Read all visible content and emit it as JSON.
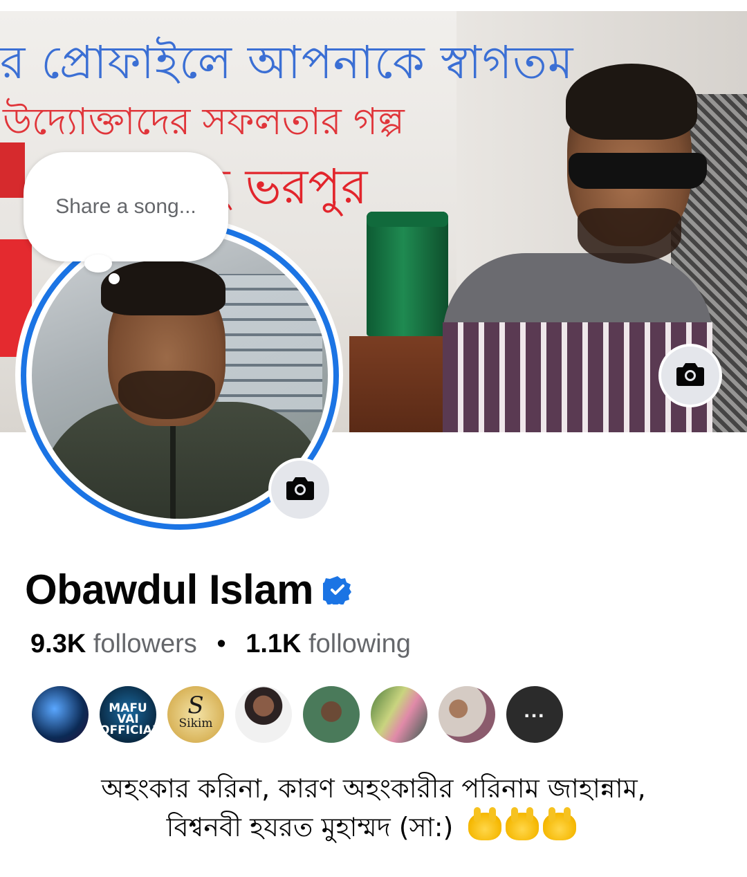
{
  "cover": {
    "banner_line1": "র প্রোফাইলে আপনাকে স্বাগতম",
    "banner_line2": "উদ্যোক্তাদের সফলতার গল্প",
    "banner_line3": "ছ ভরপুর"
  },
  "note_bubble": {
    "placeholder": "Share a song..."
  },
  "profile": {
    "name": "Obawdul Islam",
    "verified": true,
    "followers_count": "9.3K",
    "followers_label": "followers",
    "following_count": "1.1K",
    "following_label": "following",
    "separator": "•"
  },
  "friends": {
    "items": [
      {
        "icon": "avatar-photo"
      },
      {
        "text": "MAFU VAI OFFICIAL"
      },
      {
        "text": "Sikim",
        "logo_letter": "S"
      },
      {
        "icon": "avatar-photo"
      },
      {
        "icon": "avatar-photo"
      },
      {
        "icon": "avatar-photo"
      },
      {
        "icon": "avatar-photo"
      }
    ],
    "more_label": "..."
  },
  "bio": {
    "line1": "অহংকার করিনা, কারণ অহংকারীর পরিনাম জাহান্নাম,",
    "line2": "বিশ্বনবী হযরত মুহাম্মদ (সা:)",
    "emoji_count": 3,
    "emoji_icon": "palms-up-together-icon"
  },
  "icons": {
    "cover_camera": "camera-icon",
    "avatar_camera": "camera-icon",
    "verified_badge": "verified-badge-icon"
  },
  "colors": {
    "accent_blue": "#1b74e4",
    "text_primary": "#050505",
    "text_secondary": "#65676b",
    "button_gray": "#e4e6eb"
  }
}
